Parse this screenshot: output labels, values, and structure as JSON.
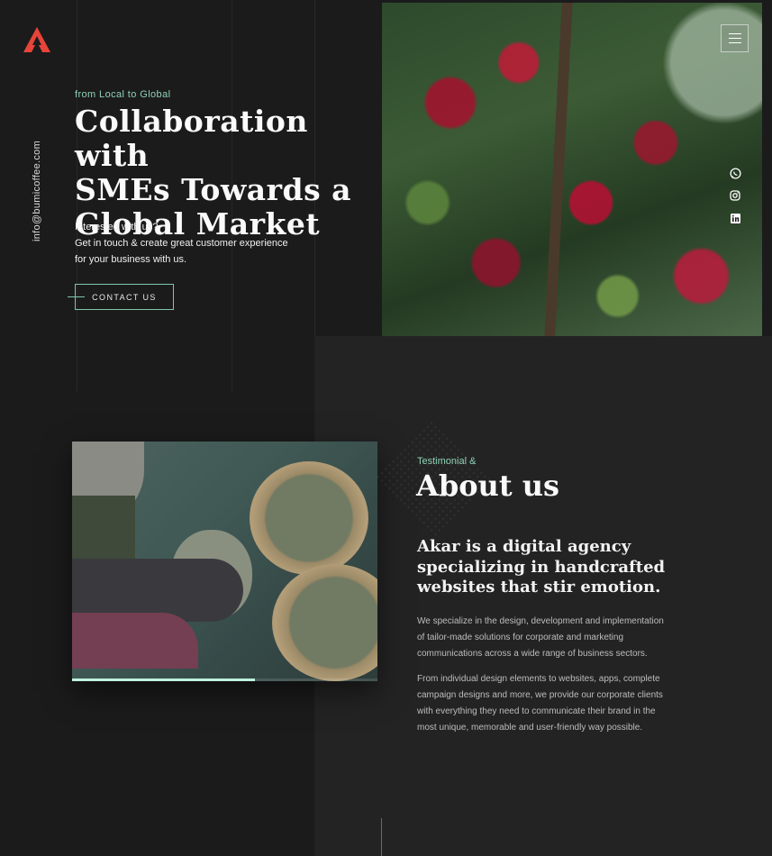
{
  "brand": {
    "logo_alt": "Akar",
    "accent_color": "#e8443a"
  },
  "side": {
    "email": "info@bumicoffee.com"
  },
  "hero": {
    "kicker": "from Local to Global",
    "title_lines": [
      "Collaboration with",
      "SMEs Towards a",
      "Global Market"
    ],
    "text_lines": [
      "Interested with us?",
      "Get in touch & create great customer experience",
      "for your business with us."
    ],
    "cta_label": "CONTACT US",
    "image_icon": "coffee-cherries-photo"
  },
  "nav": {
    "menu_icon": "hamburger-icon"
  },
  "social": [
    {
      "name": "whatsapp-icon"
    },
    {
      "name": "instagram-icon"
    },
    {
      "name": "linkedin-icon"
    }
  ],
  "about": {
    "kicker": "Testimonial &",
    "title": "About us",
    "lead_lines": [
      "Akar is a digital agency",
      "specializing in handcrafted",
      "websites that stir emotion."
    ],
    "paragraph1_lines": [
      "We specialize in the design, development and implementation",
      "of tailor-made solutions for corporate and marketing",
      "communications across a wide range of business sectors."
    ],
    "paragraph2_lines": [
      "From individual design elements to websites, apps, complete",
      "campaign designs and more, we provide our corporate clients",
      "with everything they need to communicate their brand in the",
      "most unique, memorable and user-friendly way possible."
    ],
    "image_icon": "coffee-sorting-photo",
    "slider_progress": 0.6
  },
  "colors": {
    "accent_green": "#8fd2b4",
    "background": "#1b1b1c",
    "panel": "#232324"
  }
}
